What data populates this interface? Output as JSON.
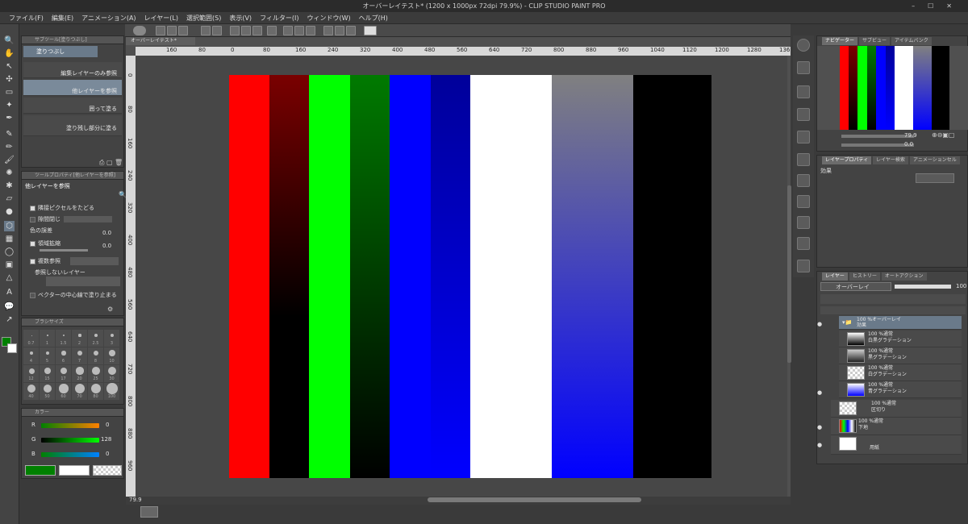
{
  "window": {
    "title": "オーバーレイテスト* (1200 x 1000px 72dpi 79.9%)  - CLIP STUDIO PAINT PRO"
  },
  "menu": [
    "ファイル(F)",
    "編集(E)",
    "アニメーション(A)",
    "レイヤー(L)",
    "選択範囲(S)",
    "表示(V)",
    "フィルター(I)",
    "ウィンドウ(W)",
    "ヘルプ(H)"
  ],
  "canvas_tab": "オーバーレイテスト*",
  "subtool": {
    "header": "サブツール[塗りつぶし]",
    "group": "塗りつぶし",
    "items": [
      "編集レイヤーのみ参照",
      "他レイヤーを参照",
      "囲って塗る",
      "塗り残し部分に塗る"
    ]
  },
  "tool_property": {
    "header": "ツールプロパティ[他レイヤーを参照]",
    "title": "他レイヤーを参照",
    "adjacent": "隣接ピクセルをたどる",
    "close_gap": "隙間閉じ",
    "color_margin": "色の誤差",
    "color_margin_value": "0.0",
    "area_scaling": "領域拡縮",
    "area_scaling_value": "0.0",
    "multi_ref": "複数参照",
    "no_ref_layer": "参照しないレイヤー",
    "vector_center": "ベクターの中心線で塗り止まる"
  },
  "brush_size": {
    "header": "ブラシサイズ",
    "sizes": [
      "0.7",
      "1",
      "1.5",
      "2",
      "2.5",
      "3",
      "4",
      "5",
      "6",
      "7",
      "8",
      "10",
      "12",
      "15",
      "17",
      "20",
      "25",
      "30",
      "40",
      "50",
      "60",
      "70",
      "80",
      "100"
    ]
  },
  "color": {
    "header": "カラー",
    "r_label": "R",
    "r_value": "0",
    "g_label": "G",
    "g_value": "128",
    "b_label": "B",
    "b_value": "0",
    "main_color": "#008000"
  },
  "rulers": {
    "top": [
      "160",
      "80",
      "0",
      "80",
      "160",
      "240",
      "320",
      "400",
      "480",
      "560",
      "640",
      "720",
      "800",
      "880",
      "960",
      "1040",
      "1120",
      "1200",
      "1280",
      "136"
    ],
    "left": [
      "0",
      "80",
      "160",
      "240",
      "320",
      "400",
      "480",
      "560",
      "640",
      "720",
      "800",
      "880",
      "960"
    ]
  },
  "status": {
    "zoom": "79.9"
  },
  "navigator": {
    "tabs": [
      "ナビゲーター",
      "サブビュー",
      "アイテムバンク"
    ],
    "zoom": "79.9",
    "angle": "0.0"
  },
  "layer_property": {
    "tabs": [
      "レイヤープロパティ",
      "レイヤー検索",
      "アニメーションセル"
    ],
    "effect": "効果"
  },
  "layers_panel": {
    "tabs": [
      "レイヤー",
      "ヒストリー",
      "オートアクション"
    ],
    "blend_mode": "オーバーレイ",
    "opacity": "100",
    "layers": [
      {
        "mode": "100 %オーバーレイ",
        "name": "効果"
      },
      {
        "mode": "100 %通常",
        "name": "白黒グラデーション"
      },
      {
        "mode": "100 %通常",
        "name": "黒グラデーション"
      },
      {
        "mode": "100 %通常",
        "name": "白グラデーション"
      },
      {
        "mode": "100 %通常",
        "name": "青グラデーション"
      },
      {
        "mode": "100 %通常",
        "name": "区切り"
      },
      {
        "mode": "100 %通常",
        "name": "下地"
      },
      {
        "mode": "",
        "name": "用紙"
      }
    ]
  },
  "icons": [
    "search-icon",
    "hand-icon",
    "zoom-icon",
    "eyedropper-icon",
    "pen-icon",
    "brush-icon",
    "eraser-icon",
    "fill-icon",
    "gradient-icon",
    "text-icon",
    "shape-icon",
    "ruler-icon",
    "eye-icon",
    "folder-icon",
    "trash-icon",
    "lock-icon"
  ]
}
